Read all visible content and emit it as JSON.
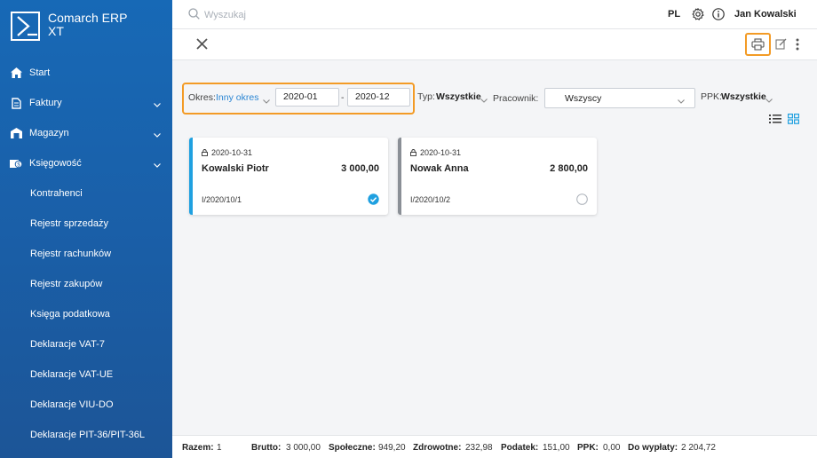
{
  "app": {
    "name_line1": "Comarch ERP",
    "name_line2": "XT"
  },
  "sidebar": {
    "items": [
      {
        "label": "Start",
        "icon": "home-icon"
      },
      {
        "label": "Faktury",
        "icon": "document-icon"
      },
      {
        "label": "Magazyn",
        "icon": "warehouse-icon"
      },
      {
        "label": "Księgowość",
        "icon": "accounting-icon"
      }
    ],
    "subitems": [
      {
        "label": "Kontrahenci"
      },
      {
        "label": "Rejestr sprzedaży"
      },
      {
        "label": "Rejestr rachunków"
      },
      {
        "label": "Rejestr zakupów"
      },
      {
        "label": "Księga podatkowa"
      },
      {
        "label": "Deklaracje VAT-7"
      },
      {
        "label": "Deklaracje VAT-UE"
      },
      {
        "label": "Deklaracje VIU-DO"
      },
      {
        "label": "Deklaracje PIT-36/PIT-36L"
      }
    ]
  },
  "topbar": {
    "search_placeholder": "Wyszukaj",
    "lang": "PL",
    "user": "Jan Kowalski"
  },
  "filters": {
    "period_label": "Okres:",
    "period_value": "Inny okres",
    "from": "2020-01",
    "separator": "-",
    "to": "2020-12",
    "type_label": "Typ:",
    "type_value": "Wszystkie",
    "employee_label": "Pracownik:",
    "employee_value": "Wszyscy",
    "ppk_label": "PPK:",
    "ppk_value": "Wszystkie"
  },
  "cards": [
    {
      "date": "2020-10-31",
      "name": "Kowalski Piotr",
      "amount": "3 000,00",
      "doc": "I/2020/10/1",
      "selected": true,
      "accent": "#1fa0e0"
    },
    {
      "date": "2020-10-31",
      "name": "Nowak Anna",
      "amount": "2 800,00",
      "doc": "I/2020/10/2",
      "selected": false,
      "accent": "#8a8f96"
    }
  ],
  "footer": {
    "count_label": "Razem:",
    "count": "1",
    "brutto_label": "Brutto:",
    "brutto": "3 000,00",
    "social_label": "Społeczne:",
    "social": "949,20",
    "health_label": "Zdrowotne:",
    "health": "232,98",
    "tax_label": "Podatek:",
    "tax": "151,00",
    "ppk_label": "PPK:",
    "ppk": "0,00",
    "net_label": "Do wypłaty:",
    "net": "2 204,72"
  },
  "colors": {
    "sidebar": "#1a5fa8",
    "accent": "#1fa0e0",
    "highlight": "#f39b26",
    "link": "#2b86d3"
  }
}
